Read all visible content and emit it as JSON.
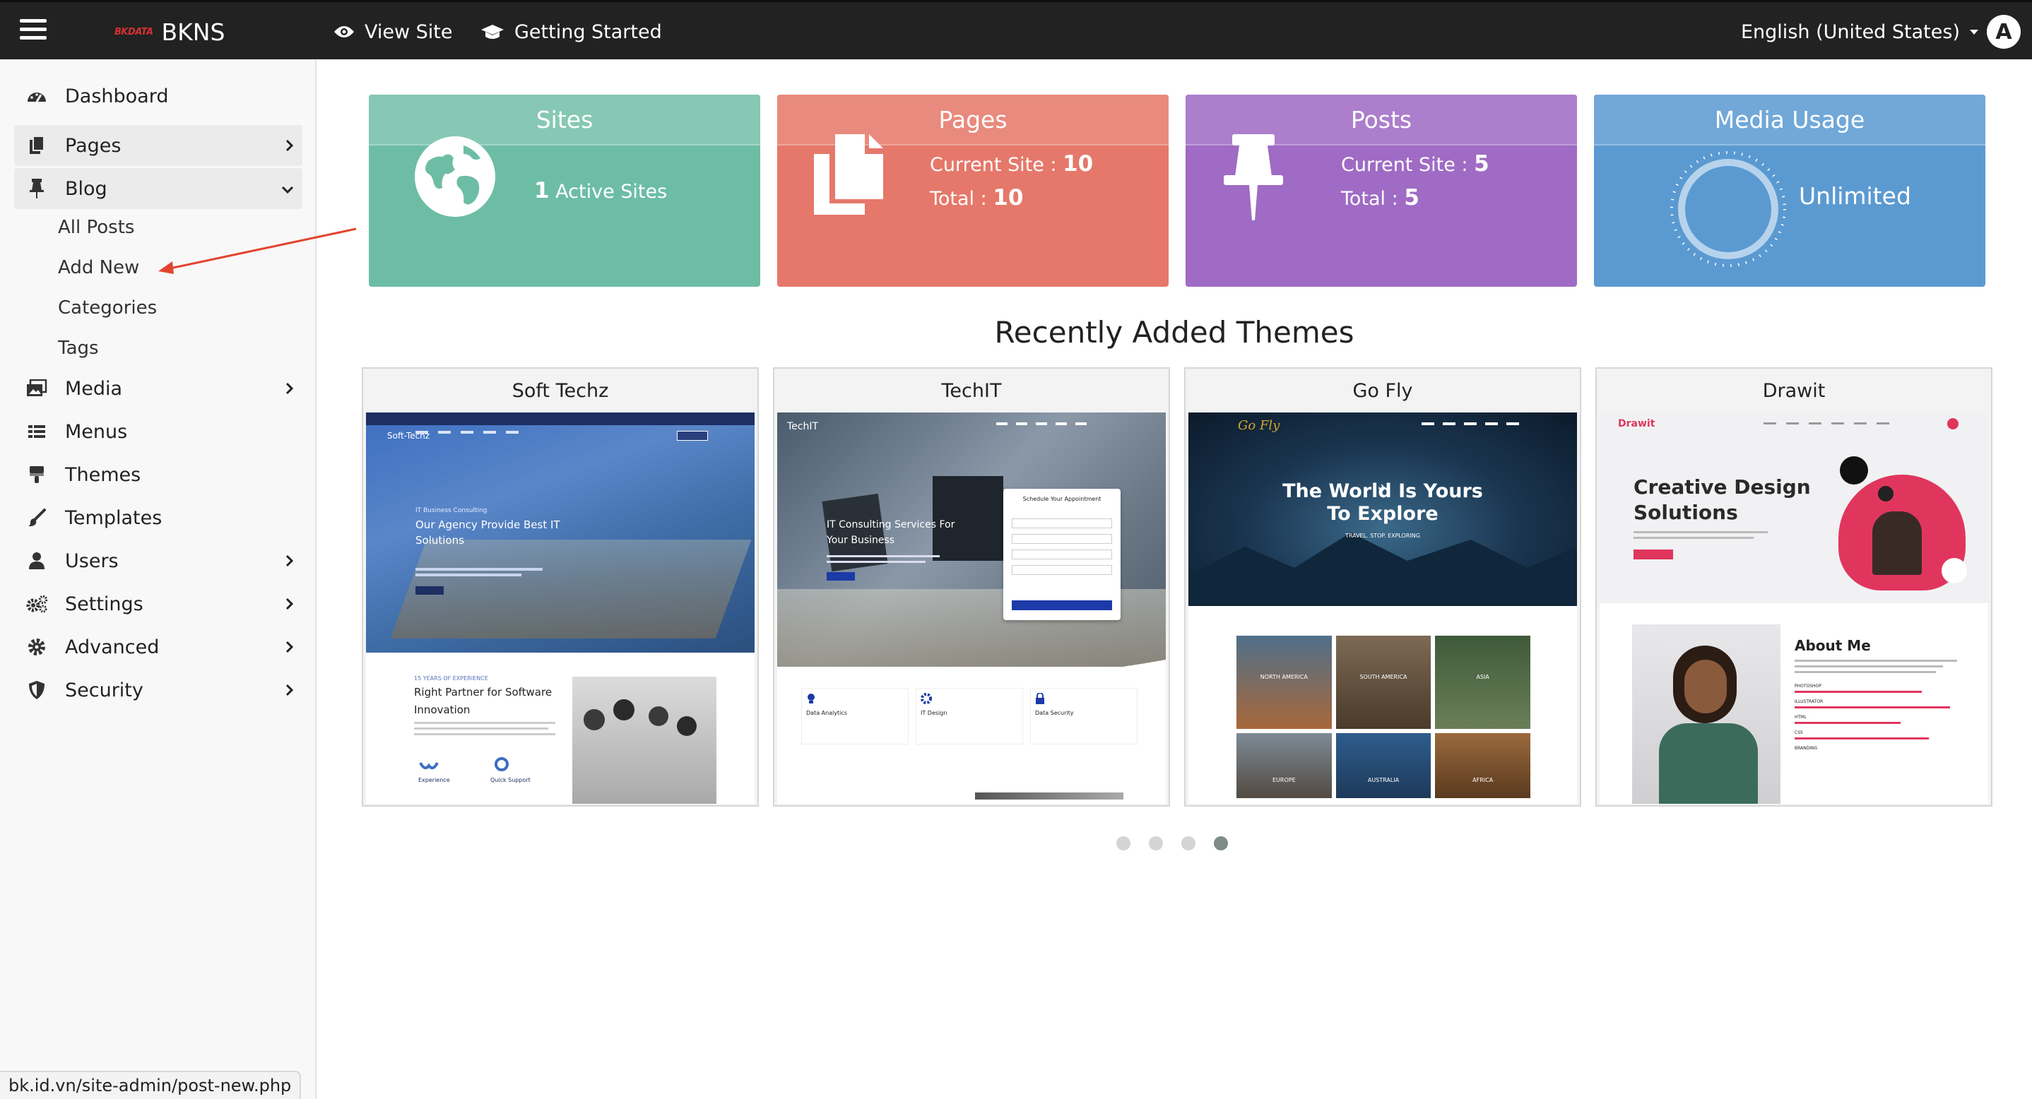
{
  "topbar": {
    "brand_small": "BKDATA",
    "brand_name": "BKNS",
    "view_site": "View Site",
    "getting_started": "Getting Started",
    "language": "English (United States)",
    "avatar": "A"
  },
  "sidebar": {
    "items": [
      {
        "label": "Dashboard",
        "icon": "dashboard-icon"
      },
      {
        "label": "Pages",
        "icon": "pages-icon"
      },
      {
        "label": "Blog",
        "icon": "pin-icon"
      },
      {
        "label": "Media",
        "icon": "media-icon"
      },
      {
        "label": "Menus",
        "icon": "menu-list-icon"
      },
      {
        "label": "Themes",
        "icon": "paint-roller-icon"
      },
      {
        "label": "Templates",
        "icon": "brush-icon"
      },
      {
        "label": "Users",
        "icon": "user-icon"
      },
      {
        "label": "Settings",
        "icon": "gears-icon"
      },
      {
        "label": "Advanced",
        "icon": "gear-icon"
      },
      {
        "label": "Security",
        "icon": "shield-icon"
      }
    ],
    "blog_sub": [
      "All Posts",
      "Add New",
      "Categories",
      "Tags"
    ]
  },
  "status_url": "bk.id.vn/site-admin/post-new.php",
  "cards": {
    "sites": {
      "title": "Sites",
      "count": "1",
      "text": "Active Sites",
      "color": "#6dbda5"
    },
    "pages": {
      "title": "Pages",
      "current_label": "Current Site : ",
      "current": "10",
      "total_label": "Total : ",
      "total": "10",
      "color": "#e5786a"
    },
    "posts": {
      "title": "Posts",
      "current_label": "Current Site : ",
      "current": "5",
      "total_label": "Total : ",
      "total": "5",
      "color": "#9f6bc4"
    },
    "media": {
      "title": "Media Usage",
      "value": "Unlimited",
      "color": "#5b9ad1"
    }
  },
  "section_title": "Recently Added Themes",
  "themes": [
    {
      "name": "Soft Techz",
      "logo": "Soft-Techz",
      "hero": "Our Agency Provide Best IT Solutions",
      "tag": "IT Business Consulting",
      "sub": "Right Partner for Software Innovation",
      "sub_tag": "15 YEARS OF EXPERIENCE",
      "f1": "Experience",
      "f2": "Quick Support"
    },
    {
      "name": "TechIT",
      "logo": "TechIT",
      "hero": "IT Consulting Services For Your Business",
      "form_title": "Schedule Your Appointment",
      "f1": "Data Analytics",
      "f2": "IT Design",
      "f3": "Data Security"
    },
    {
      "name": "Go Fly",
      "logo": "Go Fly",
      "hero": "The World Is Yours To Explore",
      "tag": "TRAVEL. STOP. EXPLORING",
      "places": [
        "NORTH AMERICA",
        "SOUTH AMERICA",
        "ASIA",
        "EUROPE",
        "AUSTRALIA",
        "AFRICA"
      ]
    },
    {
      "name": "Drawit",
      "logo": "Drawit",
      "hero": "Creative Design Solutions",
      "about": "About Me",
      "skills": [
        "PHOTOSHOP",
        "ILLUSTRATOR",
        "HTML",
        "CSS",
        "BRANDING"
      ]
    }
  ],
  "carousel": {
    "count": 4,
    "active": 4
  }
}
